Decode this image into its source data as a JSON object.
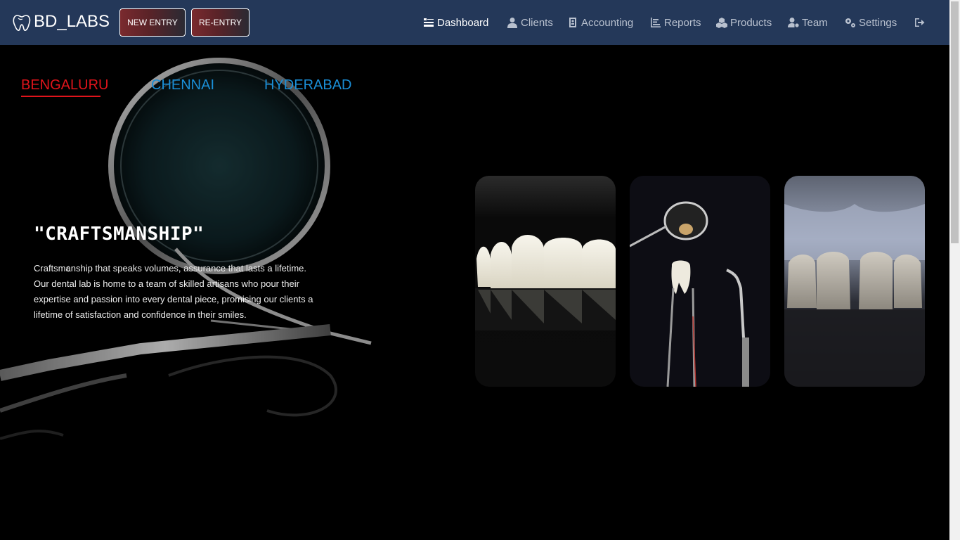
{
  "brand": {
    "name": "BD_LABS"
  },
  "header": {
    "new_entry": "NEW ENTRY",
    "re_entry": "RE-ENTRY"
  },
  "nav": {
    "dashboard": "Dashboard",
    "clients": "Clients",
    "accounting": "Accounting",
    "reports": "Reports",
    "products": "Products",
    "team": "Team",
    "settings": "Settings"
  },
  "tabs": [
    "BENGALURU",
    "CHENNAI",
    "HYDERABAD"
  ],
  "hero": {
    "title": "\"CRAFTSMANSHIP\"",
    "text": "Craftsmanship that speaks volumes, assurance that lasts a lifetime. Our dental lab is home to a team of skilled artisans who pour their expertise and passion into every dental piece, promising our clients a lifetime of satisfaction and confidence in their smiles."
  },
  "colors": {
    "navbar": "#243859",
    "active_tab": "#e0141b",
    "inactive_tab": "#1a8fd8"
  }
}
